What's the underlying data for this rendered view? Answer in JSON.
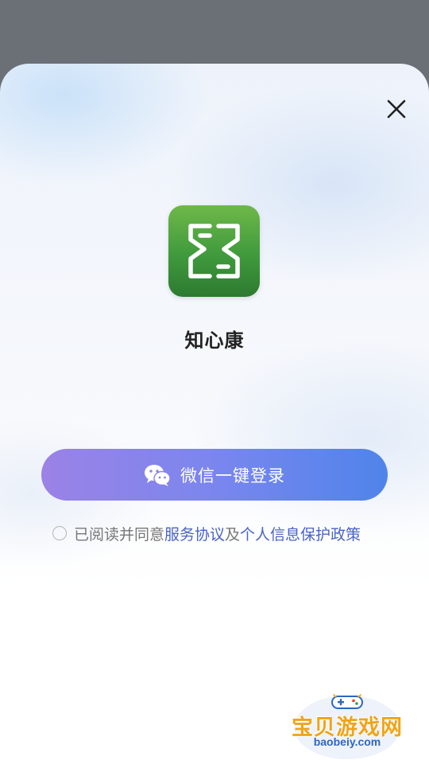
{
  "app": {
    "name": "知心康",
    "icon": "zhixinkang-logo",
    "brand_color": "#3f9a3c"
  },
  "header": {
    "close_icon": "close-icon"
  },
  "login": {
    "button_label": "微信一键登录",
    "button_icon": "wechat-icon",
    "gradient_start": "#9b82e6",
    "gradient_end": "#4f84ea"
  },
  "agreement": {
    "prefix": "已阅读并同意",
    "service_link": "服务协议",
    "joiner": "及",
    "privacy_link": "个人信息保护政策",
    "checked": false,
    "link_color": "#4a63c8"
  },
  "watermark": {
    "title": "宝贝游戏网",
    "url": "baobeiy.com"
  }
}
